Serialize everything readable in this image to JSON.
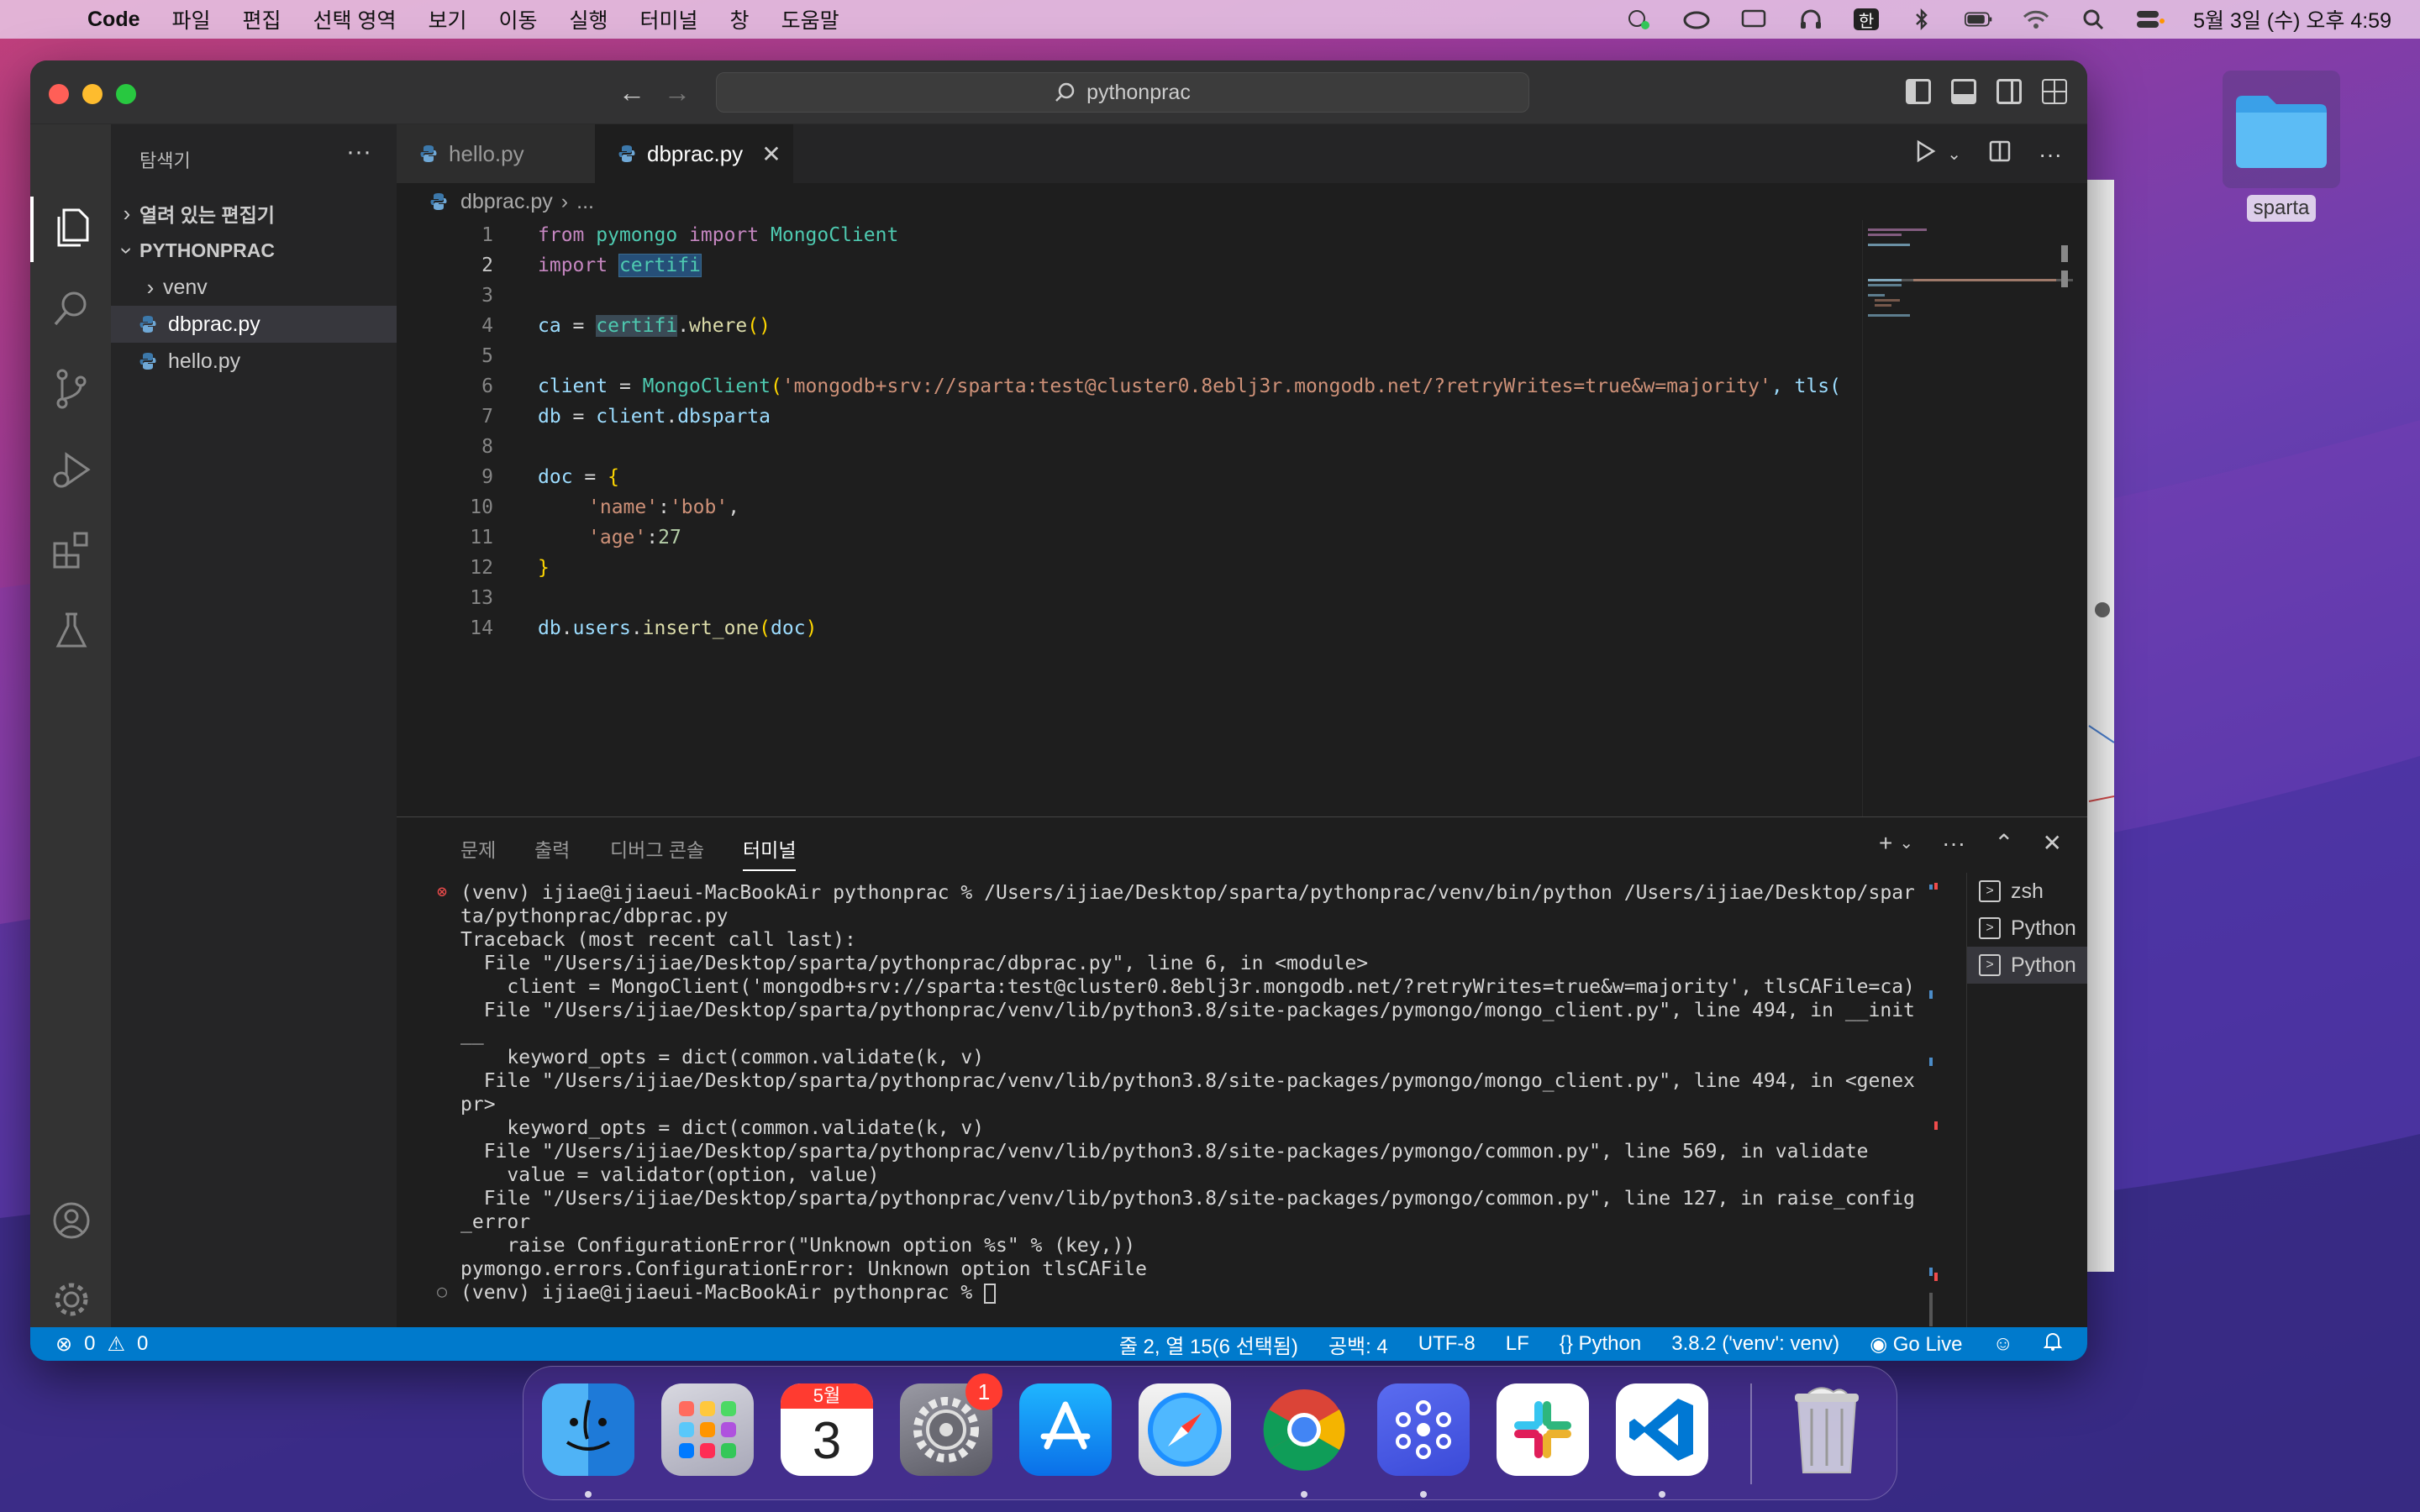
{
  "menubar": {
    "app_name": "Code",
    "items": [
      "파일",
      "편집",
      "선택 영역",
      "보기",
      "이동",
      "실행",
      "터미널",
      "창",
      "도움말"
    ],
    "clock": "5월 3일 (수) 오후 4:59",
    "input_method": "한"
  },
  "desktop": {
    "folder_label": "sparta"
  },
  "window": {
    "search_text": "pythonprac"
  },
  "sidebar": {
    "title": "탐색기",
    "open_editors": "열려 있는 편집기",
    "project": "PYTHONPRAC",
    "items": [
      "venv",
      "dbprac.py",
      "hello.py"
    ]
  },
  "tabs": [
    "hello.py",
    "dbprac.py"
  ],
  "breadcrumb": {
    "file": "dbprac.py",
    "rest": "..."
  },
  "editor": {
    "line_numbers": [
      "1",
      "2",
      "3",
      "4",
      "5",
      "6",
      "7",
      "8",
      "9",
      "10",
      "11",
      "12",
      "13",
      "14"
    ],
    "line1": {
      "a": "from",
      "b": "pymongo",
      "c": "import",
      "d": "MongoClient"
    },
    "line2": {
      "a": "import",
      "b": "certifi"
    },
    "line4": {
      "a": "ca",
      "b": " = ",
      "c": "certifi",
      "d": ".",
      "e": "where",
      "f": "()"
    },
    "line6": {
      "a": "client",
      "b": " = ",
      "c": "MongoClient",
      "d": "(",
      "e": "'mongodb+srv://sparta:test@cluster0.8eblj3r.mongodb.net/?retryWrites=true&w=majority'",
      "f": ", tls("
    },
    "line7": {
      "a": "db",
      "b": " = ",
      "c": "client",
      "d": ".",
      "e": "dbsparta"
    },
    "line9": {
      "a": "doc",
      "b": " = ",
      "c": "{"
    },
    "line10": {
      "a": "'name'",
      "b": ":",
      "c": "'bob'",
      "d": ","
    },
    "line11": {
      "a": "'age'",
      "b": ":",
      "c": "27"
    },
    "line12": {
      "a": "}"
    },
    "line14": {
      "a": "db",
      "b": ".",
      "c": "users",
      "d": ".",
      "e": "insert_one",
      "f": "(",
      "g": "doc",
      "h": ")"
    }
  },
  "panel": {
    "tabs": [
      "문제",
      "출력",
      "디버그 콘솔",
      "터미널"
    ],
    "terminal_lines": [
      "(venv) ijiae@ijiaeui-MacBookAir pythonprac % /Users/ijiae/Desktop/sparta/pythonprac/venv/bin/python /Users/ijiae/Desktop/spar",
      "ta/pythonprac/dbprac.py",
      "Traceback (most recent call last):",
      "  File \"/Users/ijiae/Desktop/sparta/pythonprac/dbprac.py\", line 6, in <module>",
      "    client = MongoClient('mongodb+srv://sparta:test@cluster0.8eblj3r.mongodb.net/?retryWrites=true&w=majority', tlsCAFile=ca)",
      "  File \"/Users/ijiae/Desktop/sparta/pythonprac/venv/lib/python3.8/site-packages/pymongo/mongo_client.py\", line 494, in __init",
      "__",
      "    keyword_opts = dict(common.validate(k, v)",
      "  File \"/Users/ijiae/Desktop/sparta/pythonprac/venv/lib/python3.8/site-packages/pymongo/mongo_client.py\", line 494, in <genex",
      "pr>",
      "    keyword_opts = dict(common.validate(k, v)",
      "  File \"/Users/ijiae/Desktop/sparta/pythonprac/venv/lib/python3.8/site-packages/pymongo/common.py\", line 569, in validate",
      "    value = validator(option, value)",
      "  File \"/Users/ijiae/Desktop/sparta/pythonprac/venv/lib/python3.8/site-packages/pymongo/common.py\", line 127, in raise_config",
      "_error",
      "    raise ConfigurationError(\"Unknown option %s\" % (key,))",
      "pymongo.errors.ConfigurationError: Unknown option tlsCAFile",
      "(venv) ijiae@ijiaeui-MacBookAir pythonprac % "
    ],
    "terminals": [
      "zsh",
      "Python",
      "Python"
    ]
  },
  "statusbar": {
    "errors": "0",
    "warnings": "0",
    "position": "줄 2, 열 15(6 선택됨)",
    "indent": "공백: 4",
    "encoding": "UTF-8",
    "eol": "LF",
    "language": "Python",
    "interpreter": "3.8.2 ('venv': venv)",
    "golive": "Go Live"
  },
  "dock": {
    "calendar_month": "5월",
    "calendar_day": "3",
    "settings_badge": "1"
  },
  "colors": {
    "statusbar": "#007acc",
    "editor_bg": "#1e1e1e",
    "sidebar_bg": "#252526",
    "activity_bg": "#333333"
  }
}
